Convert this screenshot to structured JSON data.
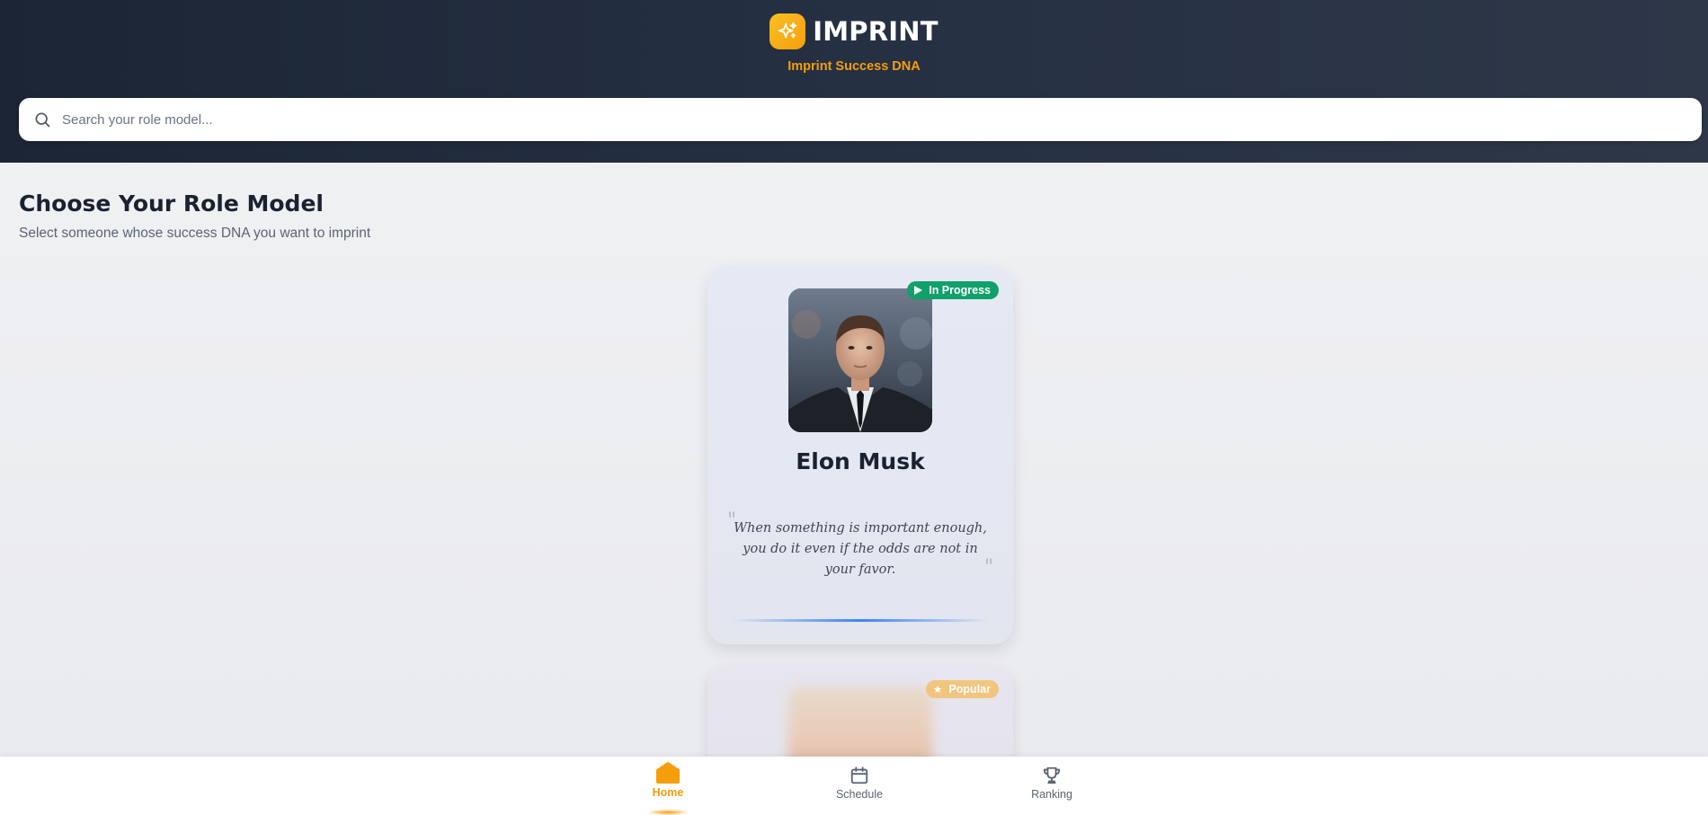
{
  "header": {
    "app_name": "IMPRINT",
    "tagline": "Imprint Success DNA",
    "logo_icon": "sparkles-icon"
  },
  "search": {
    "placeholder": "Search your role model...",
    "value": ""
  },
  "main": {
    "title": "Choose Your Role Model",
    "subtitle": "Select someone whose success DNA you want to imprint"
  },
  "cards": [
    {
      "name": "Elon Musk",
      "badge": "In Progress",
      "badge_icon": "play-icon",
      "quote": "When something is important enough, you do it even if the odds are not in your favor."
    },
    {
      "badge": "Popular",
      "badge_icon": "star-icon"
    }
  ],
  "nav": {
    "items": [
      {
        "label": "Home",
        "icon": "home-icon",
        "active": true
      },
      {
        "label": "Schedule",
        "icon": "calendar-icon",
        "active": false
      },
      {
        "label": "Ranking",
        "icon": "trophy-icon",
        "active": false
      }
    ]
  },
  "colors": {
    "accent": "#f59e0b",
    "header_dark": "#1b2535",
    "progress_badge": "#10a06a",
    "popular_badge": "#f3c37a",
    "quote_accent": "#3b82f6"
  }
}
